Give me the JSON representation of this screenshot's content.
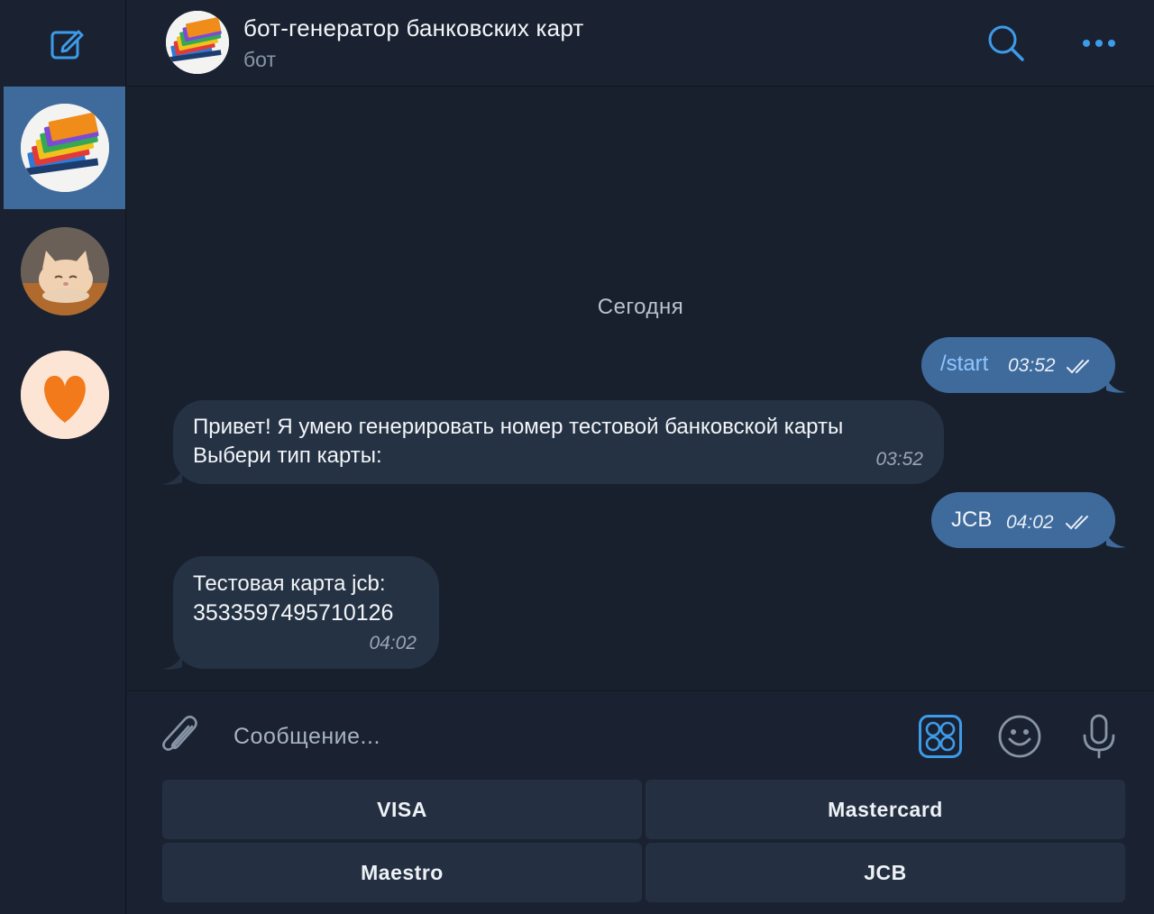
{
  "colors": {
    "accent": "#3d9be9",
    "outgoing_bubble": "#3f6a9c",
    "incoming_bubble": "#253244",
    "background": "#18202d"
  },
  "sidebar": {
    "compose_icon": "compose-icon",
    "chats": [
      {
        "avatar": "bank-cards-avatar",
        "active": true
      },
      {
        "avatar": "cat-avatar",
        "active": false
      },
      {
        "avatar": "heart-avatar",
        "active": false
      }
    ]
  },
  "header": {
    "title": "бот-генератор банковских карт",
    "subtitle": "бот",
    "search_icon": "search-icon",
    "more_icon": "more-icon"
  },
  "messages": {
    "date_separator": "Сегодня",
    "items": [
      {
        "direction": "out",
        "text": "/start",
        "time": "03:52",
        "status": "read"
      },
      {
        "direction": "in",
        "lines": [
          "Привет! Я умею генерировать номер тестовой банковской карты",
          "Выбери тип карты:"
        ],
        "time": "03:52"
      },
      {
        "direction": "out",
        "text": "JCB",
        "time": "04:02",
        "status": "read"
      },
      {
        "direction": "in",
        "lines": [
          "Тестовая карта jcb:",
          "3533597495710126"
        ],
        "time": "04:02"
      }
    ]
  },
  "composer": {
    "placeholder": "Сообщение...",
    "attach_icon": "paperclip-icon",
    "keyboard_icon": "bot-keyboard-icon",
    "emoji_icon": "emoji-icon",
    "mic_icon": "microphone-icon"
  },
  "keyboard": {
    "buttons": [
      "VISA",
      "Mastercard",
      "Maestro",
      "JCB"
    ]
  }
}
